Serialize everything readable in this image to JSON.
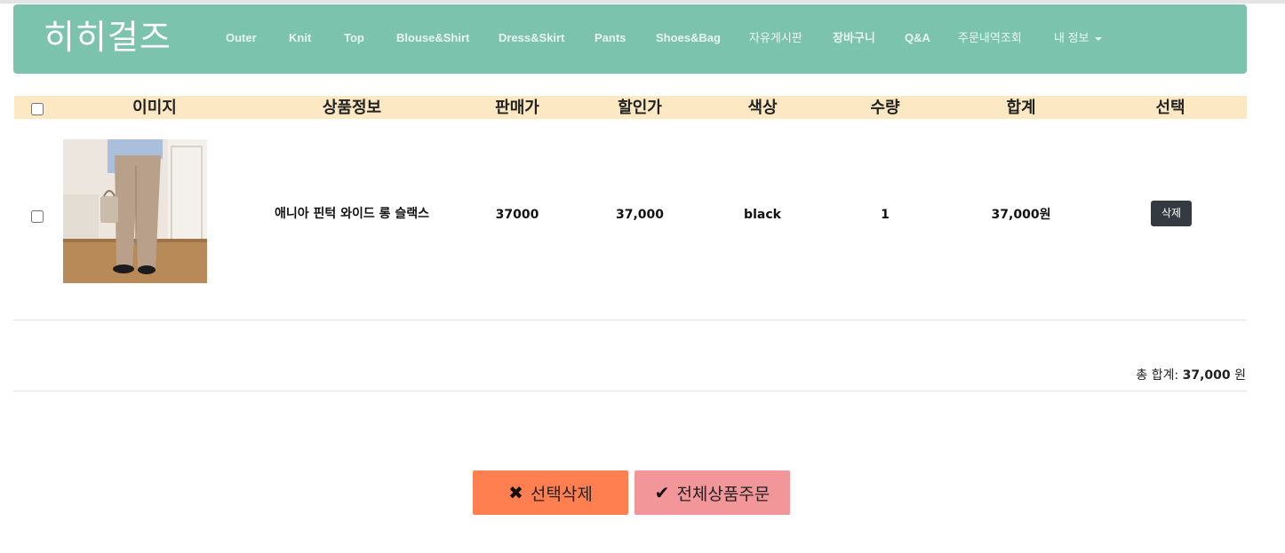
{
  "brand": "히히걸즈",
  "nav": {
    "items": [
      {
        "label": "Outer"
      },
      {
        "label": "Knit"
      },
      {
        "label": "Top"
      },
      {
        "label": "Blouse&Shirt"
      },
      {
        "label": "Dress&Skirt"
      },
      {
        "label": "Pants"
      },
      {
        "label": "Shoes&Bag"
      },
      {
        "label": "자유게시판"
      },
      {
        "label": "장바구니"
      },
      {
        "label": "Q&A"
      },
      {
        "label": "주문내역조회"
      }
    ],
    "my_info": "내 정보"
  },
  "table": {
    "headers": [
      "이미지",
      "상품정보",
      "판매가",
      "할인가",
      "색상",
      "수량",
      "합계",
      "선택"
    ],
    "rows": [
      {
        "name": "애니아 핀턱 와이드 롱 슬랙스",
        "price": "37000",
        "discount_price": "37,000",
        "color": "black",
        "quantity": "1",
        "subtotal": "37,000원",
        "delete_label": "삭제"
      }
    ]
  },
  "summary": {
    "label": "총 합계:",
    "amount": "37,000",
    "unit": "원"
  },
  "actions": {
    "delete_selected": "선택삭제",
    "order_all": "전체상품주문"
  },
  "icons": {
    "delete_selected": "x-mark-icon",
    "order_all": "check-icon"
  },
  "colors": {
    "navbar": "#7bc3ad",
    "table_header": "#fce9c3",
    "delete_selected_button": "#ff7f50",
    "order_all_button": "#f3969a",
    "row_delete_button": "#343a40"
  }
}
